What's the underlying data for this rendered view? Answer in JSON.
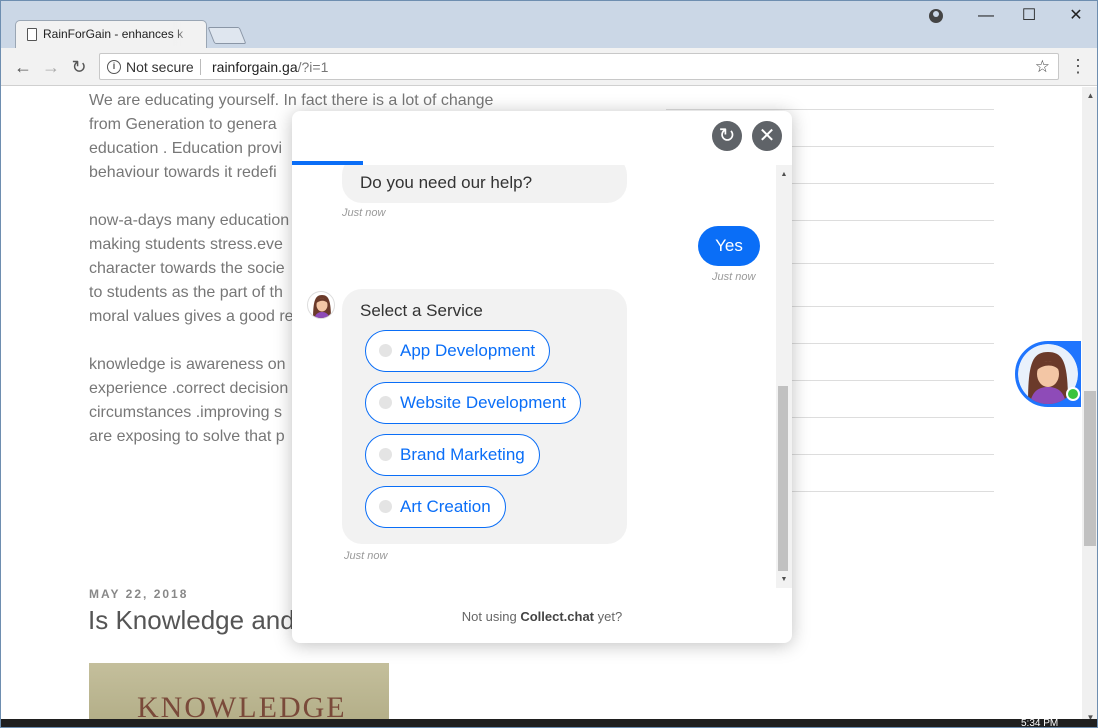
{
  "browser": {
    "tab_title": "RainForGain - enhances k",
    "security_label": "Not secure",
    "url_host": "rainforgain.ga",
    "url_path": "/?i=1"
  },
  "page": {
    "paragraphs": [
      [
        "We are  educating yourself. In fact there is a lot of change",
        "from  Generation to genera",
        "education . Education provi",
        "behaviour towards it  redefi"
      ],
      [
        "now-a-days many education",
        "making students stress.eve",
        "character towards the socie",
        "to students as the part of th",
        "moral values gives a good re"
      ],
      [
        "knowledge is awareness on",
        "experience .correct decision",
        "circumstances .improving s",
        "are exposing to solve that p"
      ]
    ],
    "post_date": "MAY 22, 2018",
    "post_title": "Is Knowledge and",
    "post_image_text": "KNOWLEDGE"
  },
  "chat": {
    "bot_question": "Do you need our help?",
    "question_time": "Just now",
    "user_reply": "Yes",
    "reply_time": "Just now",
    "service_prompt": "Select a Service",
    "options": [
      "App Development",
      "Website Development",
      "Brand Marketing",
      "Art Creation"
    ],
    "options_time": "Just now",
    "footer_prefix": "Not using",
    "footer_brand": "Collect.chat",
    "footer_suffix": "yet?",
    "accent_color": "#0a6ef7"
  },
  "taskbar": {
    "time": "5:34 PM"
  }
}
